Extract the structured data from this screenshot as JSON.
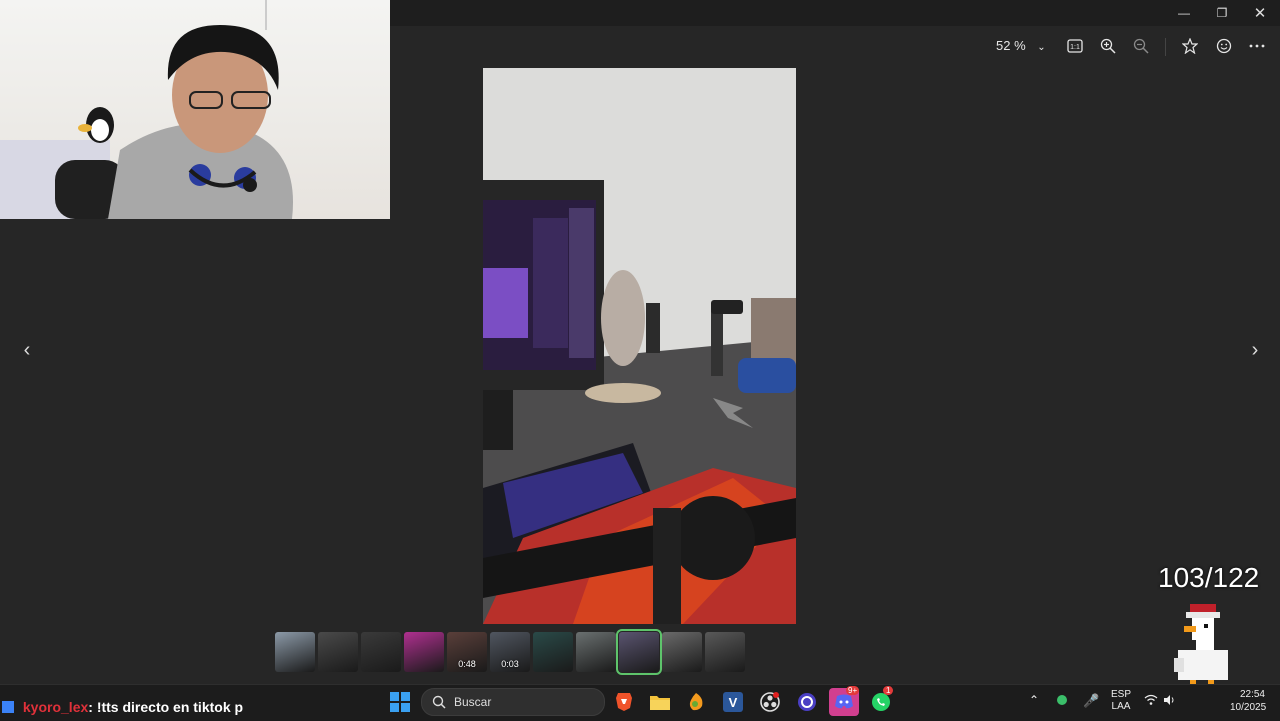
{
  "viewer": {
    "zoom_label": "52 %",
    "counter": "103/122",
    "thumbnails": [
      {
        "kind": "photo",
        "color": "#8c9aa8",
        "duration": ""
      },
      {
        "kind": "photo",
        "color": "#4a4a4a",
        "duration": ""
      },
      {
        "kind": "photo",
        "color": "#3a3a3a",
        "duration": ""
      },
      {
        "kind": "photo",
        "color": "#b03090",
        "duration": ""
      },
      {
        "kind": "video",
        "color": "#5a3f3a",
        "duration": "0:48"
      },
      {
        "kind": "video",
        "color": "#505660",
        "duration": "0:03"
      },
      {
        "kind": "photo",
        "color": "#2a4a48",
        "duration": ""
      },
      {
        "kind": "photo",
        "color": "#6a7070",
        "duration": ""
      },
      {
        "kind": "photo",
        "color": "#5a5470",
        "duration": "",
        "active": true
      },
      {
        "kind": "photo",
        "color": "#6a6a6a",
        "duration": ""
      },
      {
        "kind": "photo",
        "color": "#595959",
        "duration": ""
      }
    ]
  },
  "toolbar": {
    "icons": [
      "actual-size-icon",
      "zoom-in-icon",
      "zoom-out-icon",
      "favorite-star-icon",
      "face-icon",
      "more-icon"
    ]
  },
  "chat": {
    "user": "kyoro_lex",
    "message": ": !tts directo en tiktok p"
  },
  "taskbar": {
    "search_label": "Buscar",
    "language": "ESP",
    "layout": "LAA",
    "time": "22:54",
    "date": "10/2025",
    "whatsapp_badge": "1",
    "discord_badge": "9+"
  },
  "colors": {
    "accent_green": "#5ec46b",
    "chat_user": "#e0313a",
    "background": "#262626"
  }
}
